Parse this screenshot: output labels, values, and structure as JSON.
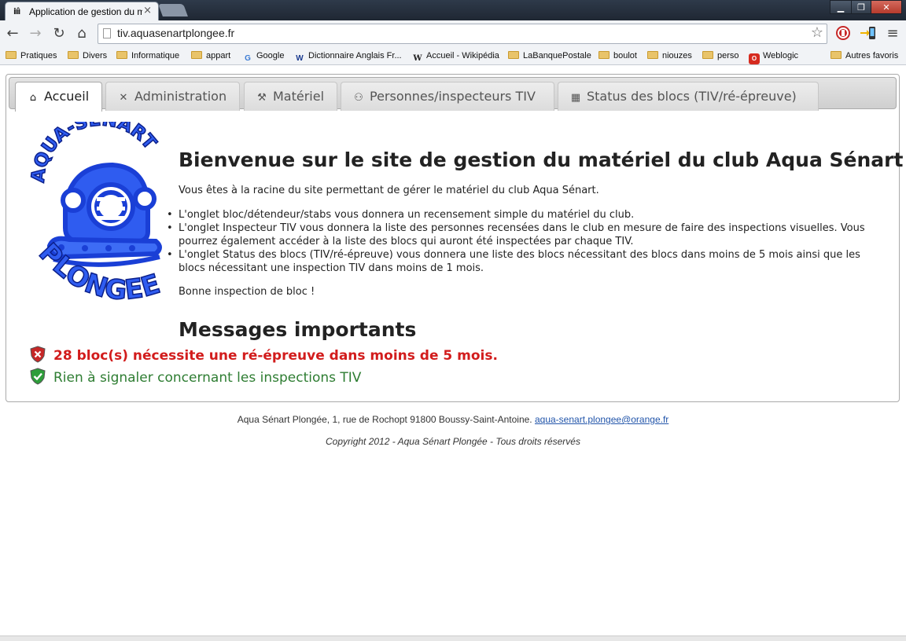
{
  "browser": {
    "tab_title": "Application de gestion du mat",
    "tab_close": "×",
    "url": "tiv.aquasenartplongee.fr",
    "window_buttons": {
      "minimize": "▁",
      "maximize": "❐",
      "close": "✕"
    },
    "nav": {
      "back": "←",
      "forward": "→",
      "reload": "↻",
      "home": "⌂",
      "star": "☆",
      "menu": "≡"
    }
  },
  "bookmarks": [
    {
      "label": "Pratiques",
      "icon": "folder-icon"
    },
    {
      "label": "Divers",
      "icon": "folder-icon"
    },
    {
      "label": "Informatique",
      "icon": "folder-icon"
    },
    {
      "label": "appart",
      "icon": "folder-icon"
    },
    {
      "label": "Google",
      "icon": "google-icon"
    },
    {
      "label": "Dictionnaire Anglais Fr...",
      "icon": "wordreference-icon"
    },
    {
      "label": "Accueil - Wikipédia",
      "icon": "wikipedia-icon"
    },
    {
      "label": "LaBanquePostale",
      "icon": "folder-icon"
    },
    {
      "label": "boulot",
      "icon": "folder-icon"
    },
    {
      "label": "niouzes",
      "icon": "folder-icon"
    },
    {
      "label": "perso",
      "icon": "folder-icon"
    },
    {
      "label": "Weblogic",
      "icon": "oracle-icon"
    },
    {
      "label": "Autres favoris",
      "icon": "folder-icon"
    }
  ],
  "tabs": [
    {
      "label": "Accueil",
      "icon": "home-icon",
      "active": true
    },
    {
      "label": "Administration",
      "icon": "tools-icon",
      "active": false
    },
    {
      "label": "Matériel",
      "icon": "wrench-icon",
      "active": false
    },
    {
      "label": "Personnes/inspecteurs TIV",
      "icon": "people-icon",
      "active": false
    },
    {
      "label": "Status des blocs (TIV/ré-épreuve)",
      "icon": "calendar-icon",
      "active": false
    }
  ],
  "logo": {
    "top_text": "AQUA-SENART",
    "bottom_text": "PLONGEE"
  },
  "main": {
    "title": "Bienvenue sur le site de gestion du matériel du club Aqua Sénart",
    "intro": "Vous êtes à la racine du site permettant de gérer le matériel du club Aqua Sénart.",
    "bullets": [
      "L'onglet bloc/détendeur/stabs vous donnera un recensement simple du matériel du club.",
      "L'onglet Inspecteur TIV vous donnera la liste des personnes recensées dans le club en mesure de faire des inspections visuelles. Vous pourrez également accéder à la liste des blocs qui auront été inspectées par chaque TIV.",
      "L'onglet Status des blocs (TIV/ré-épreuve) vous donnera une liste des blocs nécessitant des blocs dans moins de 5 mois ainsi que les blocs nécessitant une inspection TIV dans moins de 1 mois."
    ],
    "closing": "Bonne inspection de bloc !",
    "messages_title": "Messages importants",
    "messages": [
      {
        "type": "alert",
        "text": "28 bloc(s) nécessite une ré-épreuve dans moins de 5 mois."
      },
      {
        "type": "ok",
        "text": "Rien à signaler concernant les inspections TIV"
      }
    ]
  },
  "footer": {
    "address": "Aqua Sénart Plongée, 1, rue de Rochopt 91800 Boussy-Saint-Antoine.",
    "email": "aqua-senart.plongee@orange.fr",
    "copyright": "Copyright 2012 - Aqua Sénart Plongée - Tous droits réservés"
  },
  "colors": {
    "alert": "#d21c1c",
    "ok": "#2e7d32",
    "logo_blue": "#1a3fd6"
  }
}
